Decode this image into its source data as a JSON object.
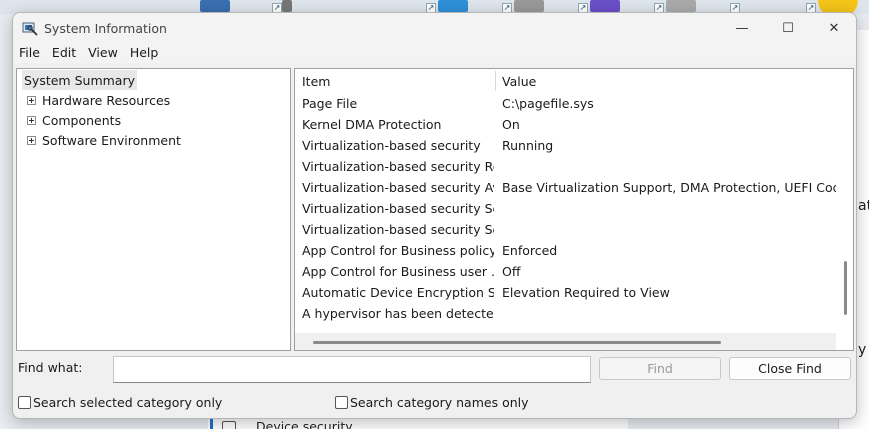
{
  "window": {
    "title": "System Information",
    "controls": {
      "minimize": "—",
      "maximize": "☐",
      "close": "✕"
    }
  },
  "menu": [
    "File",
    "Edit",
    "View",
    "Help"
  ],
  "tree": {
    "root": "System Summary",
    "children": [
      "Hardware Resources",
      "Components",
      "Software Environment"
    ]
  },
  "list": {
    "columns": {
      "item": "Item",
      "value": "Value"
    },
    "rows": [
      {
        "item": "Page File",
        "value": "C:\\pagefile.sys"
      },
      {
        "item": "Kernel DMA Protection",
        "value": "On"
      },
      {
        "item": "Virtualization-based security",
        "value": "Running"
      },
      {
        "item": "Virtualization-based security Re...",
        "value": ""
      },
      {
        "item": "Virtualization-based security Av...",
        "value": "Base Virtualization Support, DMA Protection, UEFI Code R"
      },
      {
        "item": "Virtualization-based security Se...",
        "value": ""
      },
      {
        "item": "Virtualization-based security Se...",
        "value": ""
      },
      {
        "item": "App Control for Business policy",
        "value": "Enforced"
      },
      {
        "item": "App Control for Business user ...",
        "value": "Off"
      },
      {
        "item": "Automatic Device Encryption Su...",
        "value": "Elevation Required to View"
      },
      {
        "item": "A hypervisor has been detecte...",
        "value": ""
      }
    ]
  },
  "find": {
    "label": "Find what:",
    "input_value": "",
    "find_button": "Find",
    "close_find_button": "Close Find",
    "search_selected": "Search selected category only",
    "search_names": "Search category names only"
  },
  "background": {
    "right_letters": [
      "at",
      "y"
    ],
    "bottom_text": "Device security"
  }
}
